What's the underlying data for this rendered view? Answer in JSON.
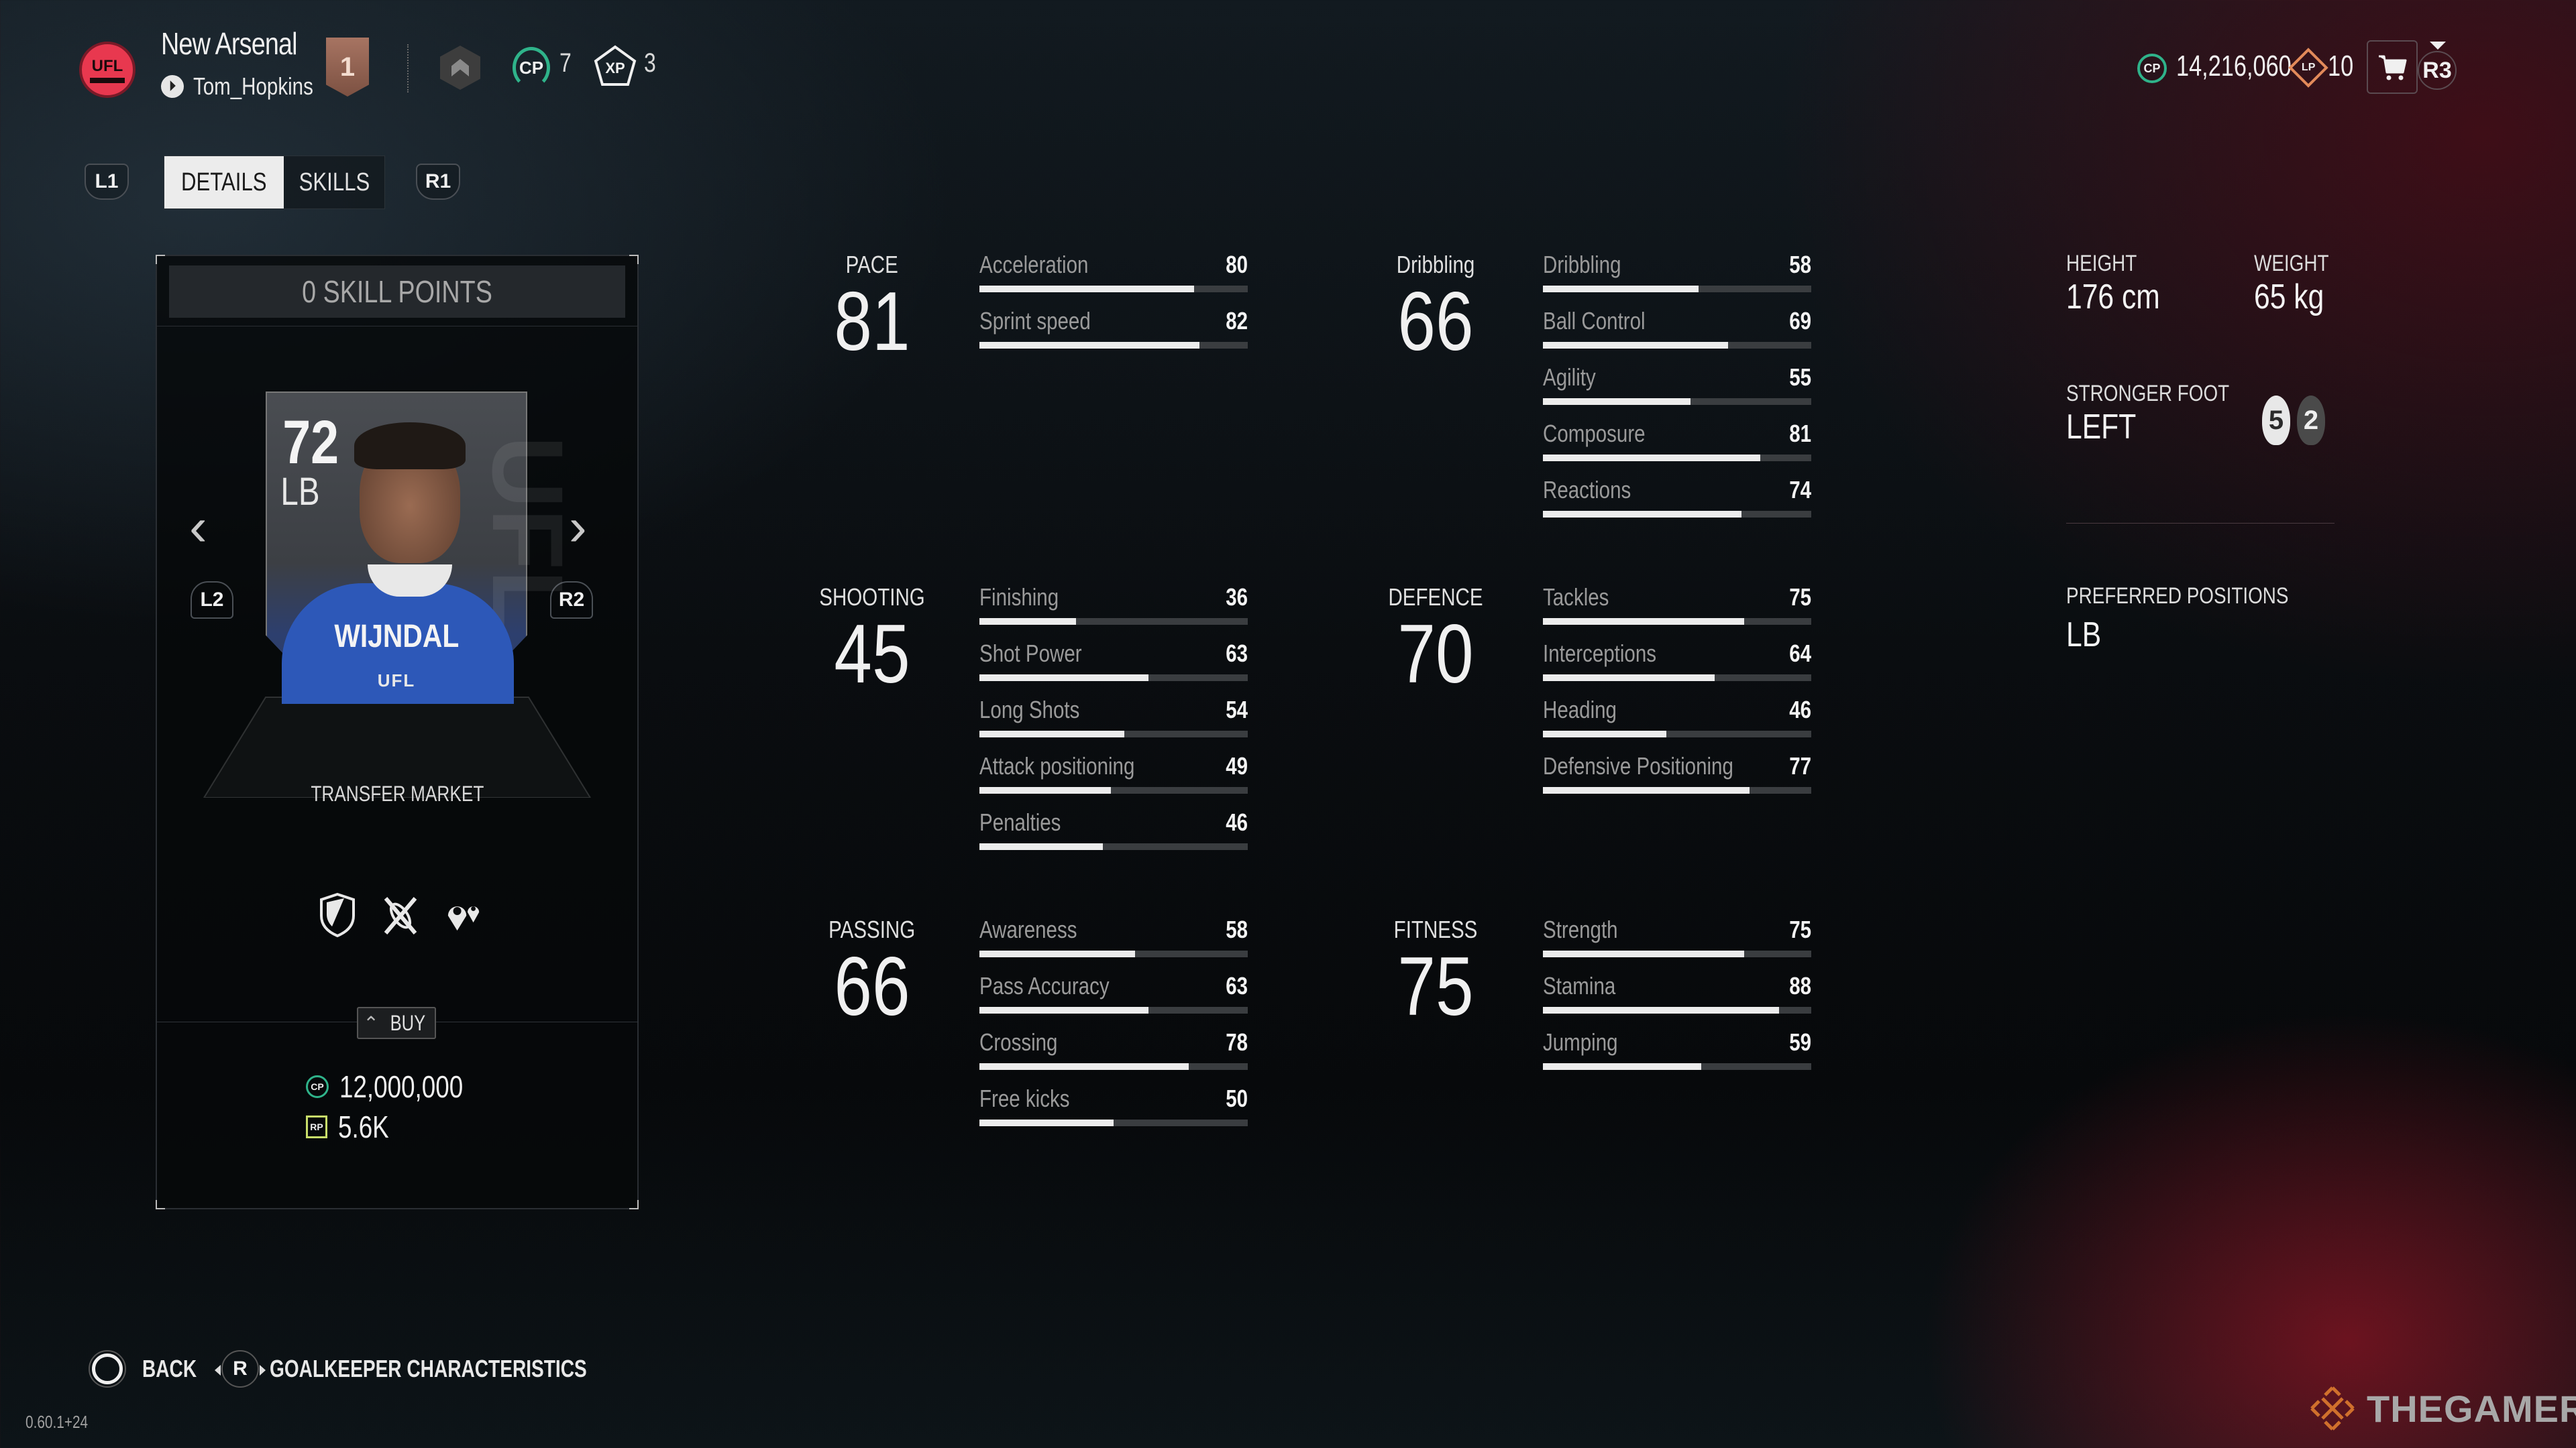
{
  "header": {
    "club_name": "New Arsenal",
    "club_logo_text": "UFL",
    "username": "Tom_Hopkins",
    "platform_icon": "playstation-icon",
    "division_rank": "1",
    "league_icon": "league-rank-icon",
    "cp_badge_label": "CP",
    "cp_level": "7",
    "xp_badge_label": "XP",
    "xp_level": "3",
    "wallet": {
      "cp_label": "CP",
      "cp_balance": "14,216,060",
      "lp_label": "LP",
      "lp_balance": "10"
    },
    "store_icon": "cart-icon",
    "r3_label": "R3"
  },
  "tabs": {
    "prev_shoulder": "L1",
    "next_shoulder": "R1",
    "items": [
      {
        "label": "DETAILS",
        "active": true
      },
      {
        "label": "SKILLS",
        "active": false
      }
    ]
  },
  "player_panel": {
    "skill_points": "0 SKILL POINTS",
    "prev_trigger": "L2",
    "next_trigger": "R2",
    "prev_arrow": "‹",
    "next_arrow": "›",
    "card": {
      "rating": "72",
      "position": "LB",
      "name": "WIJNDAL",
      "brand": "UFL",
      "watermark": "UFL"
    },
    "transfer_label": "TRANSFER MARKET",
    "role_icons": [
      "shield-icon",
      "crossed-tools-icon",
      "location-pins-icon"
    ],
    "buy_label": "BUY",
    "price_cp_label": "CP",
    "price_cp": "12,000,000",
    "price_rp_label": "RP",
    "price_rp": "5.6K"
  },
  "stat_groups": [
    {
      "label": "PACE",
      "value": "81",
      "attributes": [
        {
          "name": "Acceleration",
          "value": 80
        },
        {
          "name": "Sprint speed",
          "value": 82
        }
      ]
    },
    {
      "label": "SHOOTING",
      "value": "45",
      "attributes": [
        {
          "name": "Finishing",
          "value": 36
        },
        {
          "name": "Shot Power",
          "value": 63
        },
        {
          "name": "Long Shots",
          "value": 54
        },
        {
          "name": "Attack positioning",
          "value": 49
        },
        {
          "name": "Penalties",
          "value": 46
        }
      ]
    },
    {
      "label": "PASSING",
      "value": "66",
      "attributes": [
        {
          "name": "Awareness",
          "value": 58
        },
        {
          "name": "Pass Accuracy",
          "value": 63
        },
        {
          "name": "Crossing",
          "value": 78
        },
        {
          "name": "Free kicks",
          "value": 50
        }
      ]
    },
    {
      "label": "Dribbling",
      "value": "66",
      "attributes": [
        {
          "name": "Dribbling",
          "value": 58
        },
        {
          "name": "Ball Control",
          "value": 69
        },
        {
          "name": "Agility",
          "value": 55
        },
        {
          "name": "Composure",
          "value": 81
        },
        {
          "name": "Reactions",
          "value": 74
        }
      ]
    },
    {
      "label": "DEFENCE",
      "value": "70",
      "attributes": [
        {
          "name": "Tackles",
          "value": 75
        },
        {
          "name": "Interceptions",
          "value": 64
        },
        {
          "name": "Heading",
          "value": 46
        },
        {
          "name": "Defensive Positioning",
          "value": 77
        }
      ]
    },
    {
      "label": "FITNESS",
      "value": "75",
      "attributes": [
        {
          "name": "Strength",
          "value": 75
        },
        {
          "name": "Stamina",
          "value": 88
        },
        {
          "name": "Jumping",
          "value": 59
        }
      ]
    }
  ],
  "stat_max": 100,
  "info": {
    "height_label": "HEIGHT",
    "height_value": "176 cm",
    "weight_label": "WEIGHT",
    "weight_value": "65 kg",
    "foot_label": "STRONGER FOOT",
    "foot_value": "LEFT",
    "strong_foot_rating": "5",
    "weak_foot_rating": "2",
    "positions_label": "PREFERRED POSITIONS",
    "positions_value": "LB"
  },
  "footer": {
    "back_label": "BACK",
    "gk_stick": "R",
    "gk_label": "GOALKEEPER CHARACTERISTICS",
    "version": "0.60.1+24",
    "watermark": "THEGAMER"
  },
  "colors": {
    "cp_green": "#2fb38a",
    "lp_orange": "#e28a5a",
    "rp_yellow": "#c8de6a",
    "club_red": "#e8384f",
    "rank_bronze": "#a77462",
    "bar_fill": "#ececec",
    "bar_track": "#3a3d40"
  }
}
